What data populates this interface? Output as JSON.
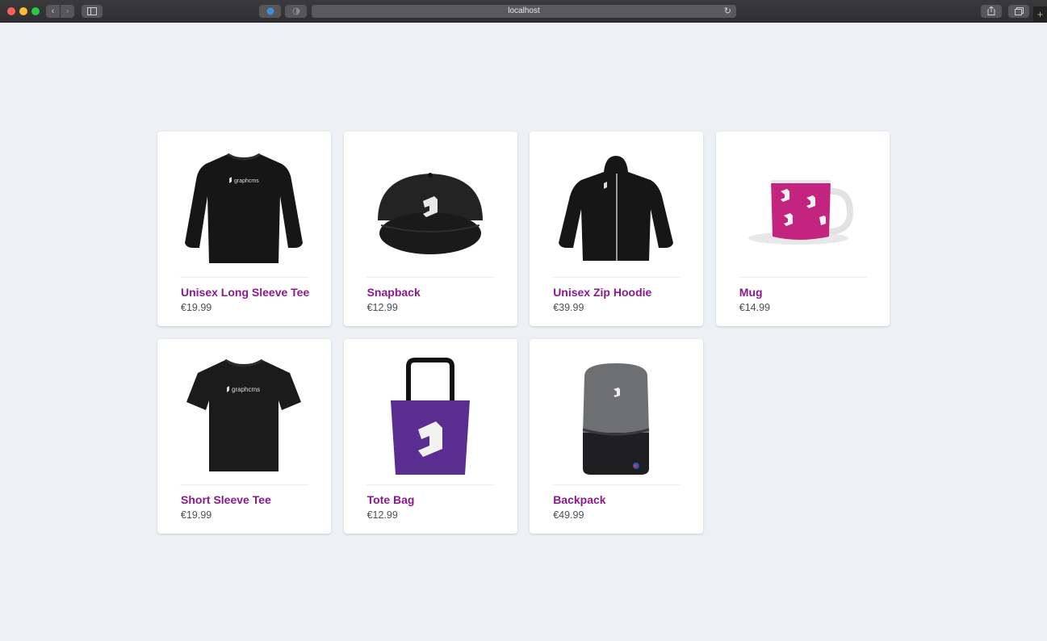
{
  "browser": {
    "url": "localhost",
    "icons": [
      "back-icon",
      "forward-icon",
      "sidebar-icon",
      "reload-icon",
      "share-icon",
      "tabs-icon",
      "plus-icon"
    ]
  },
  "products": [
    {
      "name": "Unisex Long Sleeve Tee",
      "price": "€19.99",
      "image": "long-sleeve-tee-image"
    },
    {
      "name": "Snapback",
      "price": "€12.99",
      "image": "snapback-cap-image"
    },
    {
      "name": "Unisex Zip Hoodie",
      "price": "€39.99",
      "image": "zip-hoodie-image"
    },
    {
      "name": "Mug",
      "price": "€14.99",
      "image": "mug-image"
    },
    {
      "name": "Short Sleeve Tee",
      "price": "€19.99",
      "image": "short-sleeve-tee-image"
    },
    {
      "name": "Tote Bag",
      "price": "€12.99",
      "image": "tote-bag-image"
    },
    {
      "name": "Backpack",
      "price": "€49.99",
      "image": "backpack-image"
    }
  ],
  "colors": {
    "product_name": "#8a1a8c",
    "price": "#4a4f57",
    "page_background": "#edf1f5"
  }
}
